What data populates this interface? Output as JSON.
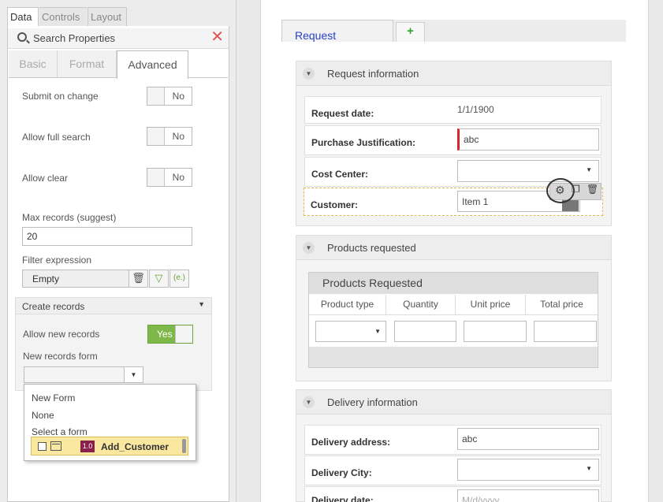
{
  "top_tabs": {
    "data": "Data",
    "controls": "Controls",
    "layout": "Layout"
  },
  "search": {
    "placeholder": "Search Properties"
  },
  "sub_tabs": {
    "basic": "Basic",
    "format": "Format",
    "advanced": "Advanced"
  },
  "props": {
    "submit_on_change": {
      "label": "Submit on change",
      "value": "No"
    },
    "allow_full_search": {
      "label": "Allow full search",
      "value": "No"
    },
    "allow_clear": {
      "label": "Allow clear",
      "value": "No"
    },
    "max_records": {
      "label": "Max records (suggest)",
      "value": "20"
    },
    "filter_expression": {
      "label": "Filter expression",
      "value": "Empty",
      "expr_label": "(e.)"
    }
  },
  "create_records": {
    "header": "Create records",
    "allow_new": {
      "label": "Allow new records",
      "value": "Yes"
    },
    "new_form": {
      "label": "New records form"
    }
  },
  "dropdown": {
    "options": [
      "New Form",
      "None",
      "Select a form"
    ],
    "selected": {
      "version": "1.0",
      "name": "Add_Customer"
    }
  },
  "form": {
    "tab_label": "Request",
    "add_tab": "+",
    "request_info": {
      "title": "Request information",
      "request_date": {
        "label": "Request date:",
        "value": "1/1/1900"
      },
      "purchase_justification": {
        "label": "Purchase Justification:",
        "value": "abc"
      },
      "cost_center": {
        "label": "Cost Center:",
        "value": ""
      },
      "customer": {
        "label": "Customer:",
        "value": "Item 1"
      }
    },
    "products": {
      "title": "Products requested",
      "grid_title": "Products Requested",
      "columns": [
        "Product type",
        "Quantity",
        "Unit price",
        "Total price"
      ]
    },
    "delivery": {
      "title": "Delivery information",
      "address": {
        "label": "Delivery address:",
        "value": "abc"
      },
      "city": {
        "label": "Delivery City:",
        "value": ""
      },
      "date": {
        "label": "Delivery date:",
        "placeholder": "M/d/yyyy"
      }
    }
  },
  "colors": {
    "accent_green": "#7fb84a",
    "tab_blue": "#2a3ecf",
    "required_red": "#d9252b",
    "version_badge": "#8a1f4a"
  }
}
